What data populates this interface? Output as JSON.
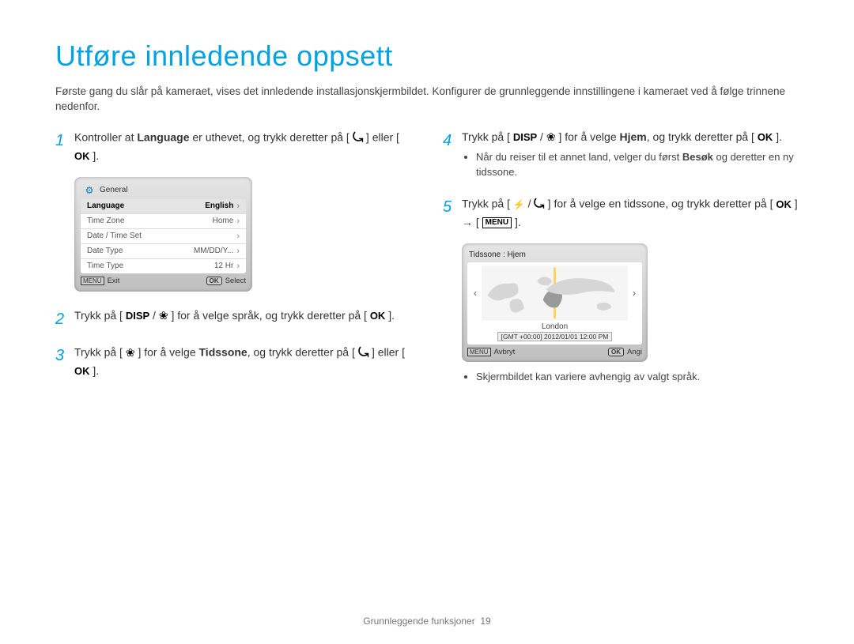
{
  "title": "Utføre innledende oppsett",
  "intro": "Første gang du slår på kameraet, vises det innledende installasjonskjermbildet. Konfigurer de grunnleggende innstillingene i kameraet ved å følge trinnene nedenfor.",
  "steps": {
    "s1": {
      "pre": "Kontroller at ",
      "bold": "Language",
      "post": " er uthevet, og trykk deretter på [ ",
      "tail": " ] eller [ ",
      "end": " ]."
    },
    "s2": {
      "pre": "Trykk på [ ",
      "mid": " / ",
      "post": " ] for å velge språk, og trykk deretter på [ ",
      "end": " ]."
    },
    "s3": {
      "pre": "Trykk på [ ",
      "post": " ] for å velge ",
      "bold": "Tidssone",
      "tail": ", og trykk deretter på [ ",
      "mid2": " ] eller [ ",
      "end": " ]."
    },
    "s4": {
      "pre": "Trykk på [ ",
      "mid": " / ",
      "post": " ] for å velge ",
      "bold": "Hjem",
      "tail": ", og trykk deretter på [ ",
      "end": " ]."
    },
    "s4_bullet": {
      "pre": "Når du reiser til et annet land, velger du først ",
      "bold": "Besøk",
      "post": " og deretter en ny tidssone."
    },
    "s5": {
      "pre": "Trykk på [ ",
      "mid": " / ",
      "post": " ] for å velge en tidssone, og trykk deretter på [ ",
      "arrow_sep": " ] → [ ",
      "end": " ]."
    }
  },
  "settings_panel": {
    "header": "General",
    "rows": {
      "r0": {
        "label": "Language",
        "value": "English"
      },
      "r1": {
        "label": "Time Zone",
        "value": "Home"
      },
      "r2": {
        "label": "Date / Time Set",
        "value": ""
      },
      "r3": {
        "label": "Date Type",
        "value": "MM/DD/Y..."
      },
      "r4": {
        "label": "Time Type",
        "value": "12 Hr"
      }
    },
    "footer_left": "Exit",
    "footer_right": "Select"
  },
  "map_panel": {
    "title": "Tidssone : Hjem",
    "city": "London",
    "gmt": "[GMT +00:00]   2012/01/01   12:00 PM",
    "footer_left": "Avbryt",
    "footer_right": "Angi"
  },
  "final_note": "Skjermbildet kan variere avhengig av valgt språk.",
  "footer": {
    "section": "Grunnleggende funksjoner",
    "page": "19"
  }
}
